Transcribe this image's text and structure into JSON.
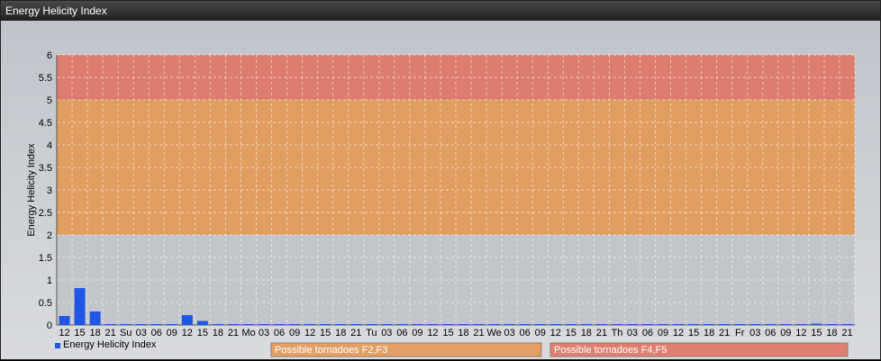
{
  "window": {
    "title": "Energy Helicity Index"
  },
  "chart_data": {
    "type": "bar",
    "ylabel": "Energy Helicity Index",
    "ylim": [
      0,
      6
    ],
    "yticks": [
      "0",
      "0.5",
      "1",
      "1.5",
      "2",
      "2.5",
      "3",
      "3.5",
      "4",
      "4.5",
      "5",
      "5.5",
      "6"
    ],
    "categories": [
      "12",
      "15",
      "18",
      "21",
      "Su",
      "03",
      "06",
      "09",
      "12",
      "15",
      "18",
      "21",
      "Mo",
      "03",
      "06",
      "09",
      "12",
      "15",
      "18",
      "21",
      "Tu",
      "03",
      "06",
      "09",
      "12",
      "15",
      "18",
      "21",
      "We",
      "03",
      "06",
      "09",
      "12",
      "15",
      "18",
      "21",
      "Th",
      "03",
      "06",
      "09",
      "12",
      "15",
      "18",
      "21",
      "Fr",
      "03",
      "06",
      "09",
      "12",
      "15",
      "18",
      "21"
    ],
    "series": [
      {
        "name": "Energy Helicity Index",
        "color": "#1f56e6",
        "values": [
          0.2,
          0.82,
          0.3,
          0.02,
          0.02,
          0.02,
          0.02,
          0.02,
          0.22,
          0.09,
          0.02,
          0.02,
          0.02,
          0.02,
          0.02,
          0.02,
          0.02,
          0.02,
          0.02,
          0.02,
          0.02,
          0.02,
          0.02,
          0.02,
          0.02,
          0.02,
          0.02,
          0.02,
          0.02,
          0.02,
          0.02,
          0.02,
          0.02,
          0.02,
          0.02,
          0.02,
          0.02,
          0.02,
          0.02,
          0.02,
          0.02,
          0.02,
          0.02,
          0.02,
          0.02,
          0.02,
          0.02,
          0.02,
          0.02,
          0.03,
          0.02,
          0.02
        ]
      }
    ],
    "bands": [
      {
        "from": 2,
        "to": 5,
        "label": "Possible tornadoes F2,F3",
        "color": "#e6974f"
      },
      {
        "from": 5,
        "to": 6,
        "label": "Possible tornadoes F4,F5",
        "color": "#e0705f"
      }
    ],
    "grid": true,
    "legend": "bottom-left"
  }
}
